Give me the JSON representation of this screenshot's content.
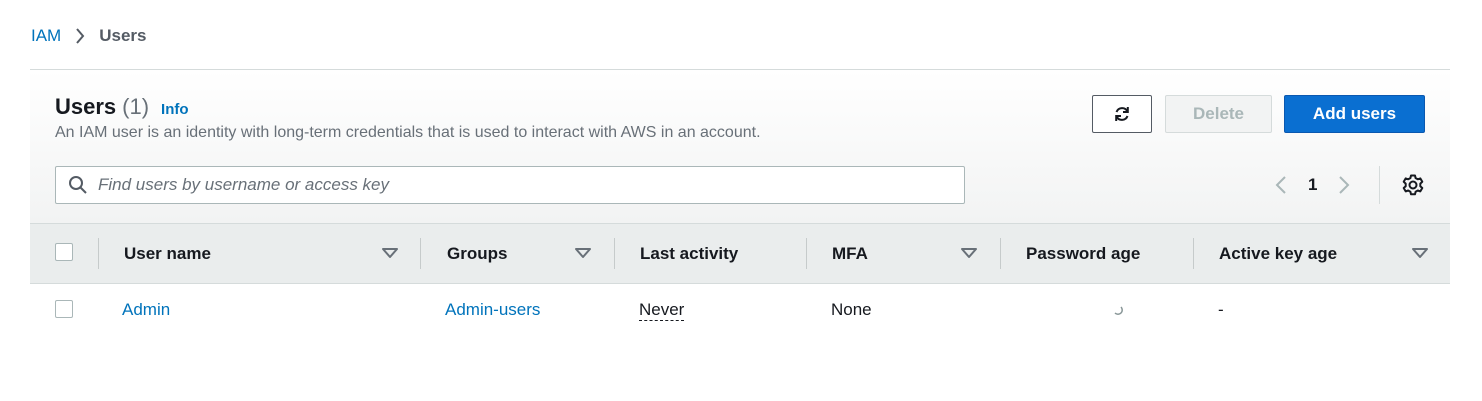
{
  "breadcrumb": {
    "root": "IAM",
    "current": "Users"
  },
  "header": {
    "title": "Users",
    "count": "(1)",
    "info": "Info",
    "description": "An IAM user is an identity with long-term credentials that is used to interact with AWS in an account."
  },
  "actions": {
    "refresh_icon": "refresh-icon",
    "delete_label": "Delete",
    "add_label": "Add users"
  },
  "search": {
    "placeholder": "Find users by username or access key",
    "value": ""
  },
  "pagination": {
    "current_page": "1"
  },
  "table": {
    "columns": [
      "User name",
      "Groups",
      "Last activity",
      "MFA",
      "Password age",
      "Active key age"
    ],
    "rows": [
      {
        "user_name": "Admin",
        "groups": "Admin-users",
        "last_activity": "Never",
        "mfa": "None",
        "password_age": "",
        "active_key_age": "-"
      }
    ]
  },
  "colors": {
    "link": "#0073bb",
    "primary_button": "#0a6fd1",
    "header_bg": "#eaeded"
  }
}
